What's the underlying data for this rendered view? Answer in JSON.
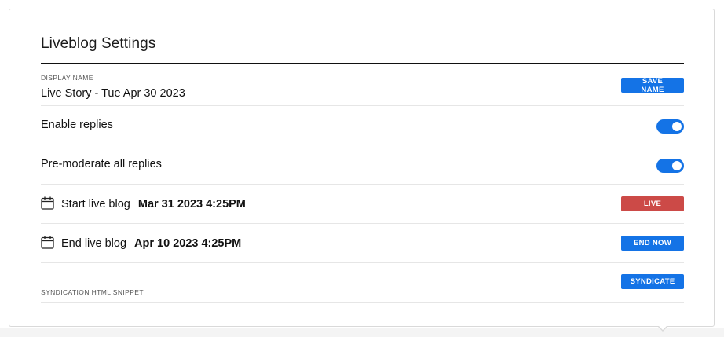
{
  "settings": {
    "title": "Liveblog Settings",
    "display_name": {
      "label": "DISPLAY NAME",
      "value": "Live Story - Tue Apr 30 2023",
      "button": "SAVE NAME"
    },
    "enable_replies": {
      "label": "Enable replies",
      "enabled": true
    },
    "premoderate": {
      "label": "Pre-moderate all replies",
      "enabled": true
    },
    "start": {
      "label": "Start live blog",
      "date": "Mar 31 2023 4:25PM",
      "button": "LIVE",
      "button_color": "#cc4a47"
    },
    "end": {
      "label": "End live blog",
      "date": "Apr 10 2023 4:25PM",
      "button": "END NOW",
      "button_color": "#1473e6"
    },
    "syndication": {
      "label": "SYNDICATION HTML SNIPPET",
      "button": "SYNDICATE"
    }
  },
  "icons": {
    "calendar": "calendar-icon"
  },
  "colors": {
    "accent": "#1473e6",
    "live": "#cc4a47"
  }
}
